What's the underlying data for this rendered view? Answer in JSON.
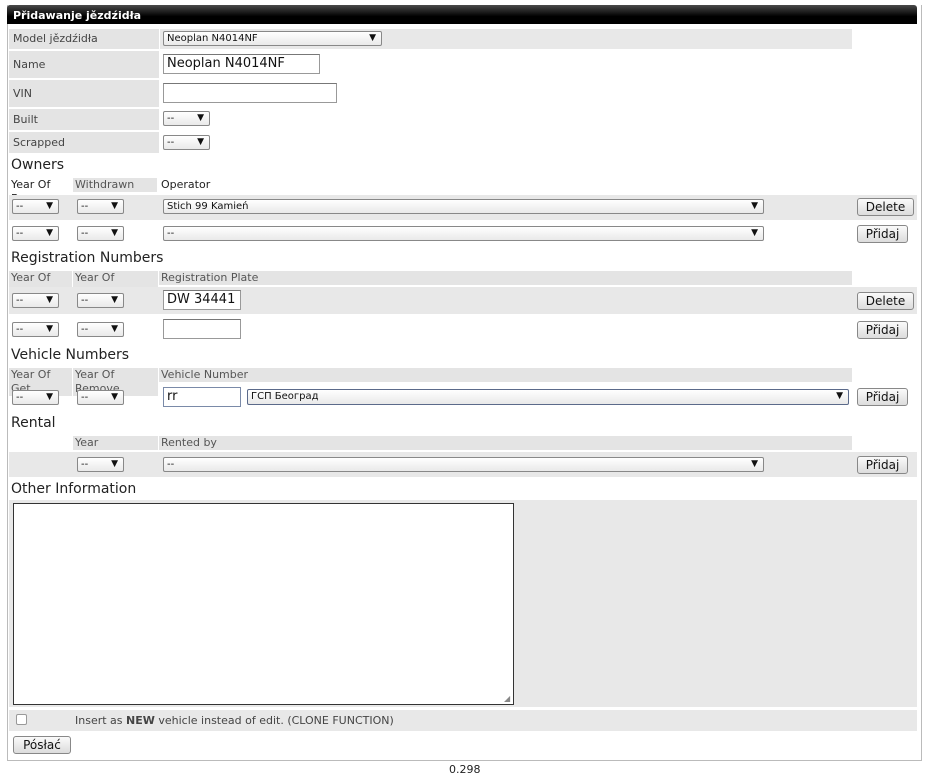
{
  "window": {
    "title": "Přidawanje jězdźidła"
  },
  "fields": {
    "model": {
      "label": "Model jězdźidła",
      "value": "Neoplan N4014NF"
    },
    "name": {
      "label": "Name",
      "value": "Neoplan N4014NF"
    },
    "vin": {
      "label": "VIN",
      "value": ""
    },
    "built": {
      "label": "Built",
      "value": "--"
    },
    "scrapped": {
      "label": "Scrapped",
      "value": "--"
    }
  },
  "owners": {
    "title": "Owners",
    "headers": [
      "Year Of Buy",
      "Withdrawn",
      "Operator"
    ],
    "rows": [
      {
        "buy": "--",
        "withdrawn": "--",
        "operator": "Stich 99 Kamień",
        "button": "Delete"
      },
      {
        "buy": "--",
        "withdrawn": "--",
        "operator": "--",
        "button": "Přidaj"
      }
    ]
  },
  "registration": {
    "title": "Registration Numbers",
    "headers": [
      "Year Of Get",
      "Year Of Remove",
      "Registration Plate"
    ],
    "rows": [
      {
        "get": "--",
        "remove": "--",
        "plate": "DW 34441",
        "button": "Delete"
      },
      {
        "get": "--",
        "remove": "--",
        "plate": "",
        "button": "Přidaj"
      }
    ]
  },
  "vehicle_numbers": {
    "title": "Vehicle Numbers",
    "headers": [
      "Year Of Get",
      "Year Of Remove",
      "Vehicle Number"
    ],
    "rows": [
      {
        "get": "--",
        "remove": "--",
        "number": "rr",
        "operator": "ГСП Београд",
        "button": "Přidaj"
      }
    ]
  },
  "rental": {
    "title": "Rental",
    "headers": [
      "Year",
      "Rented by"
    ],
    "rows": [
      {
        "year": "--",
        "rented_by": "--",
        "button": "Přidaj"
      }
    ]
  },
  "other": {
    "title": "Other Information",
    "value": ""
  },
  "clone": {
    "prefix": "Insert as ",
    "bold": "NEW",
    "suffix": " vehicle instead of edit. (CLONE FUNCTION)",
    "checked": false
  },
  "submit": {
    "label": "Pósłać"
  },
  "footer": {
    "timing": "0.298"
  },
  "colors": {
    "titlebar": "#000000",
    "label_bg": "#e4e4e4",
    "row_bg": "#e8e8e8"
  }
}
